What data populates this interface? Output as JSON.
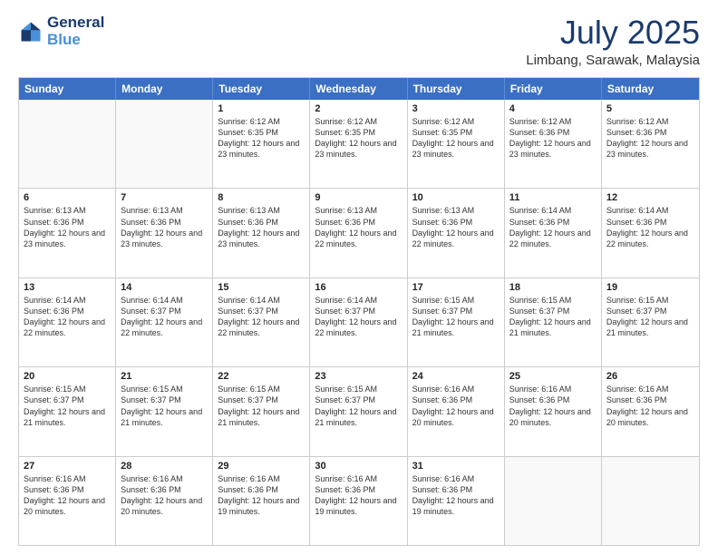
{
  "logo": {
    "line1": "General",
    "line2": "Blue"
  },
  "title": "July 2025",
  "location": "Limbang, Sarawak, Malaysia",
  "header_days": [
    "Sunday",
    "Monday",
    "Tuesday",
    "Wednesday",
    "Thursday",
    "Friday",
    "Saturday"
  ],
  "weeks": [
    [
      {
        "day": "",
        "sunrise": "",
        "sunset": "",
        "daylight": "",
        "empty": true
      },
      {
        "day": "",
        "sunrise": "",
        "sunset": "",
        "daylight": "",
        "empty": true
      },
      {
        "day": "1",
        "sunrise": "Sunrise: 6:12 AM",
        "sunset": "Sunset: 6:35 PM",
        "daylight": "Daylight: 12 hours and 23 minutes."
      },
      {
        "day": "2",
        "sunrise": "Sunrise: 6:12 AM",
        "sunset": "Sunset: 6:35 PM",
        "daylight": "Daylight: 12 hours and 23 minutes."
      },
      {
        "day": "3",
        "sunrise": "Sunrise: 6:12 AM",
        "sunset": "Sunset: 6:35 PM",
        "daylight": "Daylight: 12 hours and 23 minutes."
      },
      {
        "day": "4",
        "sunrise": "Sunrise: 6:12 AM",
        "sunset": "Sunset: 6:36 PM",
        "daylight": "Daylight: 12 hours and 23 minutes."
      },
      {
        "day": "5",
        "sunrise": "Sunrise: 6:12 AM",
        "sunset": "Sunset: 6:36 PM",
        "daylight": "Daylight: 12 hours and 23 minutes."
      }
    ],
    [
      {
        "day": "6",
        "sunrise": "Sunrise: 6:13 AM",
        "sunset": "Sunset: 6:36 PM",
        "daylight": "Daylight: 12 hours and 23 minutes."
      },
      {
        "day": "7",
        "sunrise": "Sunrise: 6:13 AM",
        "sunset": "Sunset: 6:36 PM",
        "daylight": "Daylight: 12 hours and 23 minutes."
      },
      {
        "day": "8",
        "sunrise": "Sunrise: 6:13 AM",
        "sunset": "Sunset: 6:36 PM",
        "daylight": "Daylight: 12 hours and 23 minutes."
      },
      {
        "day": "9",
        "sunrise": "Sunrise: 6:13 AM",
        "sunset": "Sunset: 6:36 PM",
        "daylight": "Daylight: 12 hours and 22 minutes."
      },
      {
        "day": "10",
        "sunrise": "Sunrise: 6:13 AM",
        "sunset": "Sunset: 6:36 PM",
        "daylight": "Daylight: 12 hours and 22 minutes."
      },
      {
        "day": "11",
        "sunrise": "Sunrise: 6:14 AM",
        "sunset": "Sunset: 6:36 PM",
        "daylight": "Daylight: 12 hours and 22 minutes."
      },
      {
        "day": "12",
        "sunrise": "Sunrise: 6:14 AM",
        "sunset": "Sunset: 6:36 PM",
        "daylight": "Daylight: 12 hours and 22 minutes."
      }
    ],
    [
      {
        "day": "13",
        "sunrise": "Sunrise: 6:14 AM",
        "sunset": "Sunset: 6:36 PM",
        "daylight": "Daylight: 12 hours and 22 minutes."
      },
      {
        "day": "14",
        "sunrise": "Sunrise: 6:14 AM",
        "sunset": "Sunset: 6:37 PM",
        "daylight": "Daylight: 12 hours and 22 minutes."
      },
      {
        "day": "15",
        "sunrise": "Sunrise: 6:14 AM",
        "sunset": "Sunset: 6:37 PM",
        "daylight": "Daylight: 12 hours and 22 minutes."
      },
      {
        "day": "16",
        "sunrise": "Sunrise: 6:14 AM",
        "sunset": "Sunset: 6:37 PM",
        "daylight": "Daylight: 12 hours and 22 minutes."
      },
      {
        "day": "17",
        "sunrise": "Sunrise: 6:15 AM",
        "sunset": "Sunset: 6:37 PM",
        "daylight": "Daylight: 12 hours and 21 minutes."
      },
      {
        "day": "18",
        "sunrise": "Sunrise: 6:15 AM",
        "sunset": "Sunset: 6:37 PM",
        "daylight": "Daylight: 12 hours and 21 minutes."
      },
      {
        "day": "19",
        "sunrise": "Sunrise: 6:15 AM",
        "sunset": "Sunset: 6:37 PM",
        "daylight": "Daylight: 12 hours and 21 minutes."
      }
    ],
    [
      {
        "day": "20",
        "sunrise": "Sunrise: 6:15 AM",
        "sunset": "Sunset: 6:37 PM",
        "daylight": "Daylight: 12 hours and 21 minutes."
      },
      {
        "day": "21",
        "sunrise": "Sunrise: 6:15 AM",
        "sunset": "Sunset: 6:37 PM",
        "daylight": "Daylight: 12 hours and 21 minutes."
      },
      {
        "day": "22",
        "sunrise": "Sunrise: 6:15 AM",
        "sunset": "Sunset: 6:37 PM",
        "daylight": "Daylight: 12 hours and 21 minutes."
      },
      {
        "day": "23",
        "sunrise": "Sunrise: 6:15 AM",
        "sunset": "Sunset: 6:37 PM",
        "daylight": "Daylight: 12 hours and 21 minutes."
      },
      {
        "day": "24",
        "sunrise": "Sunrise: 6:16 AM",
        "sunset": "Sunset: 6:36 PM",
        "daylight": "Daylight: 12 hours and 20 minutes."
      },
      {
        "day": "25",
        "sunrise": "Sunrise: 6:16 AM",
        "sunset": "Sunset: 6:36 PM",
        "daylight": "Daylight: 12 hours and 20 minutes."
      },
      {
        "day": "26",
        "sunrise": "Sunrise: 6:16 AM",
        "sunset": "Sunset: 6:36 PM",
        "daylight": "Daylight: 12 hours and 20 minutes."
      }
    ],
    [
      {
        "day": "27",
        "sunrise": "Sunrise: 6:16 AM",
        "sunset": "Sunset: 6:36 PM",
        "daylight": "Daylight: 12 hours and 20 minutes."
      },
      {
        "day": "28",
        "sunrise": "Sunrise: 6:16 AM",
        "sunset": "Sunset: 6:36 PM",
        "daylight": "Daylight: 12 hours and 20 minutes."
      },
      {
        "day": "29",
        "sunrise": "Sunrise: 6:16 AM",
        "sunset": "Sunset: 6:36 PM",
        "daylight": "Daylight: 12 hours and 19 minutes."
      },
      {
        "day": "30",
        "sunrise": "Sunrise: 6:16 AM",
        "sunset": "Sunset: 6:36 PM",
        "daylight": "Daylight: 12 hours and 19 minutes."
      },
      {
        "day": "31",
        "sunrise": "Sunrise: 6:16 AM",
        "sunset": "Sunset: 6:36 PM",
        "daylight": "Daylight: 12 hours and 19 minutes."
      },
      {
        "day": "",
        "sunrise": "",
        "sunset": "",
        "daylight": "",
        "empty": true
      },
      {
        "day": "",
        "sunrise": "",
        "sunset": "",
        "daylight": "",
        "empty": true
      }
    ]
  ]
}
